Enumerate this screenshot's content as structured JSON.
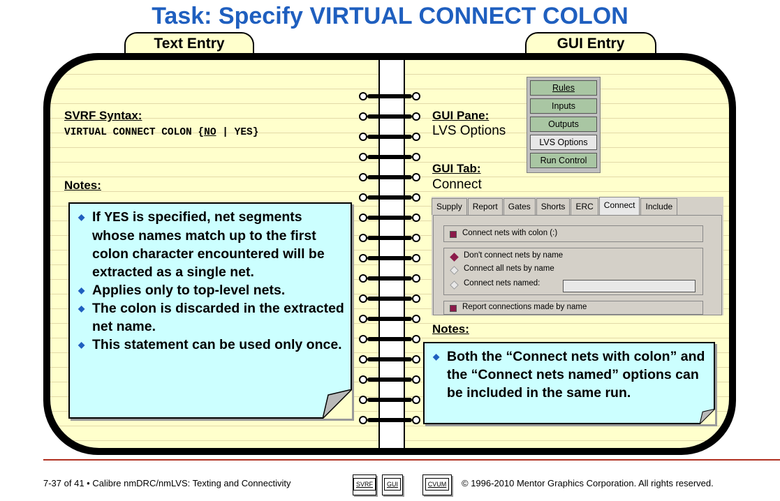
{
  "title": "Task: Specify VIRTUAL CONNECT COLON",
  "tabs": {
    "text_entry": "Text Entry",
    "gui_entry": "GUI Entry"
  },
  "left": {
    "syntax_label": "SVRF Syntax:",
    "syntax_prefix": "VIRTUAL CONNECT COLON {",
    "syntax_no": "NO",
    "syntax_suffix": " | YES}",
    "notes_label": "Notes:",
    "notes": {
      "n1_a": "If ",
      "n1_code": "YES",
      "n1_b": " is specified, net segments whose names match up to the first colon character encountered will be extracted as a single net.",
      "n2": "Applies only to top-level nets.",
      "n3": "The colon is discarded in the extracted net name.",
      "n4": "This statement can be used only once."
    }
  },
  "right": {
    "gui_pane_label": "GUI Pane:",
    "gui_pane_value": "LVS Options",
    "gui_tab_label": "GUI Tab:",
    "gui_tab_value": "Connect",
    "notes_label": "Notes:",
    "note": "Both the “Connect nets with colon” and the “Connect nets named” options can be included in the same run."
  },
  "pane_buttons": [
    "Rules",
    "Inputs",
    "Outputs",
    "LVS Options",
    "Run Control"
  ],
  "gui_tabs": [
    "Supply",
    "Report",
    "Gates",
    "Shorts",
    "ERC",
    "Connect",
    "Include"
  ],
  "connect_panel": {
    "colon_checkbox": "Connect nets with colon (:)",
    "radio_dont": "Don't connect nets by name",
    "radio_all": "Connect all nets by name",
    "radio_named": "Connect nets named:",
    "report_checkbox": "Report connections made by name"
  },
  "footer": {
    "left": "7-37 of 41 • Calibre nmDRC/nmLVS: Texting and Connectivity",
    "nav": [
      "SVRF",
      "GUI",
      "CVUM"
    ],
    "right": "© 1996-2010 Mentor Graphics Corporation. All rights reserved."
  },
  "colors": {
    "title": "#1f5fbf",
    "page": "#ffffcc",
    "callout": "#ccffff",
    "pane_button": "#a9c6a3",
    "footer_rule": "#b03020"
  }
}
